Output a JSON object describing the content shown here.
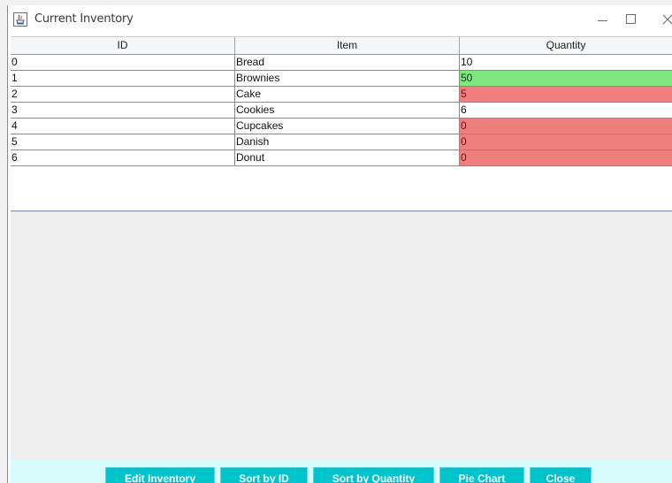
{
  "window": {
    "title": "Current Inventory"
  },
  "table": {
    "headers": [
      "ID",
      "Item",
      "Quantity"
    ],
    "rows": [
      {
        "id": "0",
        "item": "Bread",
        "quantity": "10",
        "status": "normal"
      },
      {
        "id": "1",
        "item": "Brownies",
        "quantity": "50",
        "status": "high"
      },
      {
        "id": "2",
        "item": "Cake",
        "quantity": "5",
        "status": "low"
      },
      {
        "id": "3",
        "item": "Cookies",
        "quantity": "6",
        "status": "normal"
      },
      {
        "id": "4",
        "item": "Cupcakes",
        "quantity": "0",
        "status": "low"
      },
      {
        "id": "5",
        "item": "Danish",
        "quantity": "0",
        "status": "low"
      },
      {
        "id": "6",
        "item": "Donut",
        "quantity": "0",
        "status": "low"
      }
    ]
  },
  "buttons": {
    "edit_inventory": "Edit Inventory",
    "sort_by_id": "Sort by ID",
    "sort_by_quantity": "Sort by Quantity",
    "pie_chart": "Pie Chart",
    "close": "Close"
  },
  "colors": {
    "low_stock": "#ef7f7f",
    "high_stock": "#7ee87e",
    "button": "#00c4cc",
    "button_bar": "#d7fbfb"
  },
  "icons": {
    "app": "java-app-icon",
    "minimize": "minimize-icon",
    "maximize": "maximize-icon",
    "close": "close-icon"
  }
}
